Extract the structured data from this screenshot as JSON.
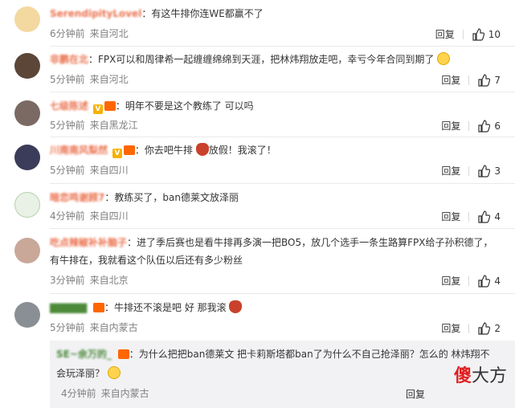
{
  "comments": [
    {
      "username": "SerendipityLovel",
      "text": "有这牛排你连WE都赢不了",
      "time": "6分钟前",
      "location": "来自河北",
      "reply_label": "回复",
      "likes": "10",
      "avatar_color": "#f3d8a0"
    },
    {
      "username": "非鹏在北",
      "text": "FPX可以和周律希一起缠缠绵绵到天涯，把林炜翔放走吧，幸亏今年合同到期了",
      "time": "5分钟前",
      "location": "来自河北",
      "reply_label": "回复",
      "likes": "7",
      "avatar_color": "#5b4638"
    },
    {
      "username": "七级陈述",
      "text": "明年不要是这个教练了 可以吗",
      "time": "5分钟前",
      "location": "来自黑龙江",
      "reply_label": "回复",
      "likes": "6",
      "avatar_color": "#7a6a63"
    },
    {
      "username": "川南南风梨然",
      "text": "你去吧牛排",
      "text2": "放假！我滚了！",
      "time": "5分钟前",
      "location": "来自四川",
      "reply_label": "回复",
      "likes": "3",
      "avatar_color": "#3b3b5a"
    },
    {
      "username": "暗恋鸣谢顾7",
      "text": "教练买了，ban德莱文放泽丽",
      "time": "4分钟前",
      "location": "来自四川",
      "reply_label": "回复",
      "likes": "4",
      "avatar_color": "#e9f1e6"
    },
    {
      "username": "吃点辣椒补补脑子",
      "text": "进了季后赛也是看牛排再多演一把BO5，放几个选手一条生路算FPX给子孙积德了，有牛排在，我就看这个队伍以后还有多少粉丝",
      "time": "3分钟前",
      "location": "来自北京",
      "reply_label": "回复",
      "likes": "4",
      "avatar_color": "#c9a89a"
    },
    {
      "username": "▇▇▇▇▇",
      "text": "牛排还不滚是吧 好 那我滚",
      "time": "5分钟前",
      "location": "来自内蒙古",
      "reply_label": "回复",
      "likes": "2",
      "avatar_color": "#8a8f95"
    }
  ],
  "nested_reply": {
    "username": "SE~余万的_",
    "text": "为什么把把ban德莱文 把卡莉斯塔都ban了为什么不自己抢泽丽？怎么的 林炜翔不会玩泽丽？",
    "time": "4分钟前",
    "location": "来自内蒙古",
    "reply_label": "回复"
  },
  "watermark": {
    "part1": "傻",
    "part2": "大方"
  },
  "colors": {
    "username": "#eb7350",
    "meta": "#808080",
    "nested_bg": "#f2f2f5"
  },
  "icons": {
    "like": "thumbs-up-icon"
  }
}
